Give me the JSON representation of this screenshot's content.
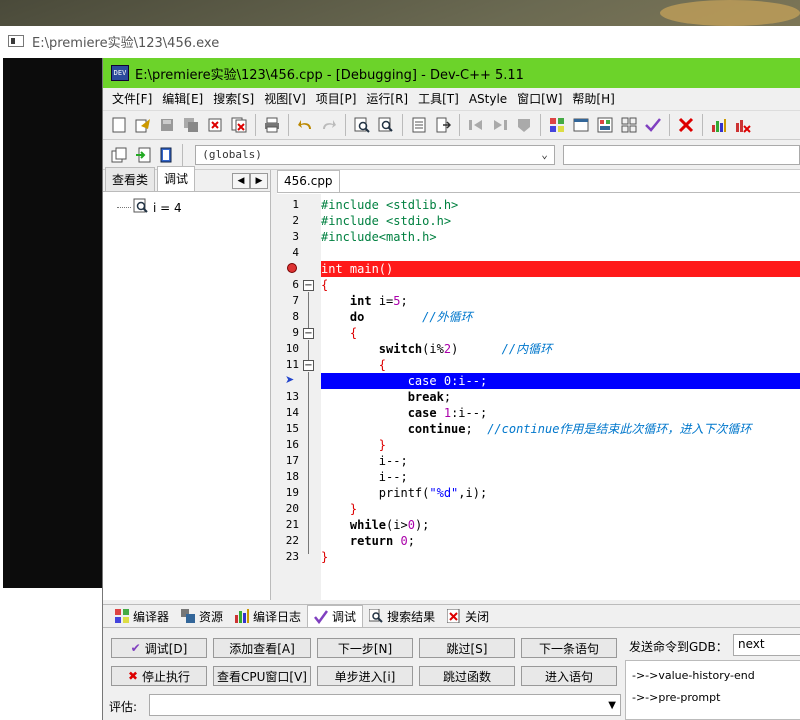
{
  "console": {
    "title": "E:\\premiere实验\\123\\456.exe"
  },
  "window": {
    "title": "E:\\premiere实验\\123\\456.cpp - [Debugging] - Dev-C++ 5.11",
    "app_icon": "dev-cpp-icon"
  },
  "menu": [
    "文件[F]",
    "编辑[E]",
    "搜索[S]",
    "视图[V]",
    "项目[P]",
    "运行[R]",
    "工具[T]",
    "AStyle",
    "窗口[W]",
    "帮助[H]"
  ],
  "scope_select": {
    "value": "(globals)"
  },
  "left_panel": {
    "tabs": [
      "查看类",
      "调试"
    ],
    "active_tab": "调试",
    "watch": [
      {
        "expr": "i = 4"
      }
    ]
  },
  "editor": {
    "tab": "456.cpp",
    "breakpoint_line": 5,
    "current_line": 12,
    "lines": [
      {
        "n": "1"
      },
      {
        "n": "2"
      },
      {
        "n": "3"
      },
      {
        "n": "4"
      },
      {
        "n": "5"
      },
      {
        "n": "6"
      },
      {
        "n": "7"
      },
      {
        "n": "8"
      },
      {
        "n": "9"
      },
      {
        "n": "10"
      },
      {
        "n": "11"
      },
      {
        "n": "12"
      },
      {
        "n": "13"
      },
      {
        "n": "14"
      },
      {
        "n": "15"
      },
      {
        "n": "16"
      },
      {
        "n": "17"
      },
      {
        "n": "18"
      },
      {
        "n": "19"
      },
      {
        "n": "20"
      },
      {
        "n": "21"
      },
      {
        "n": "22"
      },
      {
        "n": "23"
      }
    ],
    "code": {
      "l1a": "#include <stdlib.h>",
      "l2a": "#include <stdio.h>",
      "l3a": "#include<math.h>",
      "l5a": "int main()",
      "l6a": "{",
      "l7a": "    ",
      "l7b": "int",
      "l7c": " i=",
      "l7d": "5",
      "l7e": ";",
      "l8a": "    ",
      "l8b": "do",
      "l8c": "        ",
      "l8d": "//外循环",
      "l9a": "    {",
      "l10a": "        ",
      "l10b": "switch",
      "l10c": "(i%",
      "l10d": "2",
      "l10e": ")      ",
      "l10f": "//内循环",
      "l11a": "        {",
      "l12a": "            ",
      "l12b": "case",
      "l12c": " ",
      "l12d": "0",
      "l12e": ":i--;",
      "l13a": "            ",
      "l13b": "break",
      "l13c": ";",
      "l14a": "            ",
      "l14b": "case",
      "l14c": " ",
      "l14d": "1",
      "l14e": ":i--;",
      "l15a": "            ",
      "l15b": "continue",
      "l15c": ";  ",
      "l15d": "//continue作用是结束此次循环，进入下次循环",
      "l16a": "        }",
      "l17a": "        i--;",
      "l18a": "        i--;",
      "l19a": "        printf(",
      "l19b": "\"%d\"",
      "l19c": ",i);",
      "l20a": "    }",
      "l21a": "    ",
      "l21b": "while",
      "l21c": "(i>",
      "l21d": "0",
      "l21e": ");",
      "l22a": "    ",
      "l22b": "return",
      "l22c": " ",
      "l22d": "0",
      "l22e": ";",
      "l23a": "}"
    }
  },
  "bottom_tabs": [
    {
      "label": "编译器",
      "icon": "grid-icon"
    },
    {
      "label": "资源",
      "icon": "resources-icon"
    },
    {
      "label": "编译日志",
      "icon": "chart-icon"
    },
    {
      "label": "调试",
      "icon": "check-icon"
    },
    {
      "label": "搜索结果",
      "icon": "search-icon"
    },
    {
      "label": "关闭",
      "icon": "close-icon"
    }
  ],
  "debug_buttons": {
    "debug": "调试[D]",
    "add_watch": "添加查看[A]",
    "next_step": "下一步[N]",
    "skip": "跳过[S]",
    "next_statement": "下一条语句",
    "stop": "停止执行",
    "cpu_window": "查看CPU窗口[V]",
    "step_into": "单步进入[i]",
    "skip_function": "跳过函数",
    "into_statement": "进入语句"
  },
  "gdb": {
    "label": "发送命令到GDB：",
    "input": "next",
    "output": [
      "->->value-history-end",
      "->->pre-prompt"
    ]
  },
  "eval": {
    "label": "评估:",
    "value": ""
  },
  "colors": {
    "title_bar": "#6cd32a",
    "breakpoint_line": "#ff1a1a",
    "current_line": "#0000ff"
  }
}
